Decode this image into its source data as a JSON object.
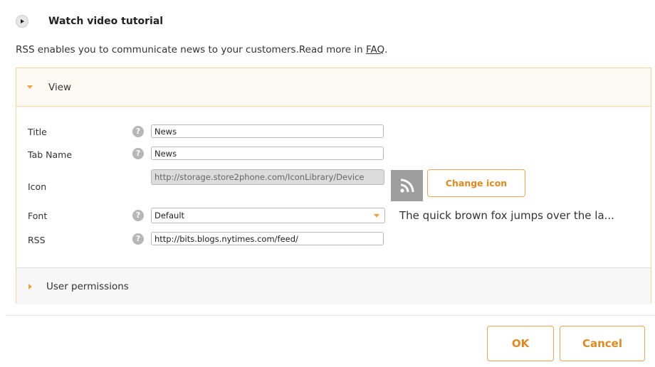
{
  "tutorial": {
    "label": "Watch video tutorial",
    "icon": "play-icon"
  },
  "intro": {
    "text": "RSS enables you to communicate news to your customers.Read more in ",
    "link": "FAQ",
    "end": "."
  },
  "view_section": {
    "label": "View",
    "expanded": true
  },
  "form": {
    "title": {
      "label": "Title",
      "value": "News"
    },
    "tab_name": {
      "label": "Tab Name",
      "value": "News"
    },
    "icon": {
      "label": "Icon",
      "value": "http://storage.store2phone.com/IconLibrary/Device",
      "change_button": "Change icon",
      "preview": "rss-icon"
    },
    "font": {
      "label": "Font",
      "selected": "Default",
      "preview": "The quick brown fox jumps over the la..."
    },
    "rss": {
      "label": "RSS",
      "value": "http://bits.blogs.nytimes.com/feed/"
    }
  },
  "permissions_section": {
    "label": "User permissions",
    "expanded": false
  },
  "footer": {
    "ok": "OK",
    "cancel": "Cancel"
  },
  "colors": {
    "accent": "#e08a1e",
    "panel_border": "#f2d79d",
    "caret": "#f0a33a"
  }
}
